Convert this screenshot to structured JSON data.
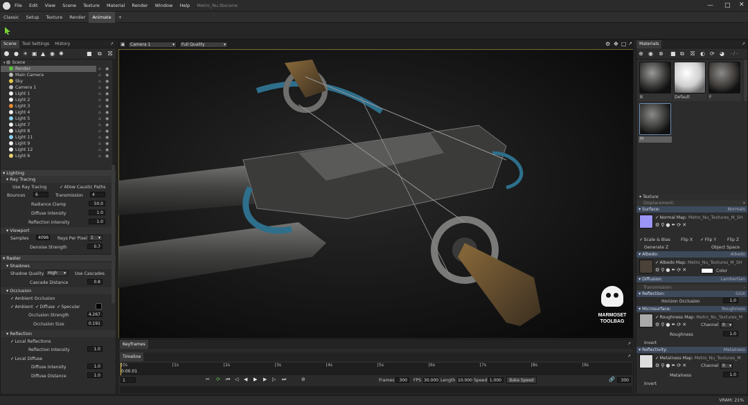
{
  "titlebar": {
    "menus": [
      "File",
      "Edit",
      "View",
      "Scene",
      "Texture",
      "Material",
      "Render",
      "Window",
      "Help"
    ],
    "filename": "Metro_Nu.tbscene"
  },
  "workspace_tabs": [
    "Classic",
    "Setup",
    "Texture",
    "Render",
    "Animate",
    "+"
  ],
  "left_panel": {
    "tabs": [
      "Scene",
      "Tool Settings",
      "History"
    ],
    "tree": {
      "root": "Scene",
      "items": [
        "Render",
        "Main Camera",
        "Sky",
        "Camera 1",
        "Light 1",
        "Light 2",
        "Light 3",
        "Light 4",
        "Light 5",
        "Light 7",
        "Light 8",
        "Light 11",
        "Light 9",
        "Light 12",
        "Light 6"
      ],
      "icon_colors": [
        "#5bbf3e",
        "#bbbbbb",
        "#e3c94a",
        "#bbbbbb",
        "#eeeeee",
        "#eeeeee",
        "#e88a30",
        "#eeeeee",
        "#8ad0f0",
        "#eeeeee",
        "#eeeeee",
        "#8ad0f0",
        "#eeeeee",
        "#eeeeee",
        "#e8d070"
      ]
    },
    "lighting": {
      "title": "Lighting",
      "ray_tracing": "Ray Tracing",
      "use_ray_tracing": "Use Ray Tracing",
      "allow_caustic": "Allow Caustic Paths",
      "bounces_label": "Bounces",
      "bounces": "6",
      "transmission_label": "Transmission",
      "transmission": "4",
      "radiance_clamp_label": "Radiance Clamp",
      "radiance_clamp": "50.0",
      "diffuse_intensity_label": "Diffuse Intensity",
      "diffuse_intensity": "1.0",
      "reflection_intensity_label": "Reflection Intensity",
      "reflection_intensity": "1.0",
      "viewport": "Viewport",
      "samples_label": "Samples",
      "samples": "4096",
      "rays_label": "Rays Per Pixel",
      "rays": "1",
      "denoise_label": "Denoise Strength",
      "denoise": "0.7"
    },
    "raster": {
      "title": "Raster",
      "shadows": "Shadows",
      "shadow_quality_label": "Shadow Quality",
      "shadow_quality": "High",
      "use_cascades": "Use Cascades",
      "cascade_label": "Cascade Distance",
      "cascade": "0.8",
      "occlusion": "Occlusion",
      "ambient_occlusion": "Ambient Occlusion",
      "ambient": "Ambient",
      "diffuse": "Diffuse",
      "specular": "Specular",
      "occ_strength_label": "Occlusion Strength",
      "occ_strength": "4.267",
      "occ_size_label": "Occlusion Size",
      "occ_size": "0.191",
      "reflection": "Reflection",
      "local_reflections": "Local Reflections",
      "refl_intensity_label": "Reflection Intensity",
      "refl_intensity": "1.0",
      "local_diffuse": "Local Diffuse",
      "diff_intensity_label": "Diffuse Intensity",
      "diff_intensity": "1.0",
      "diff_distance_label": "Diffuse Distance",
      "diff_distance": "1.0"
    }
  },
  "viewport": {
    "camera": "Camera 1",
    "quality": "Full Quality",
    "logo_line1": "MARMOSET",
    "logo_line2": "TOOLBAG"
  },
  "timeline": {
    "keyframes_tab": "Keyframes",
    "timeline_tab": "Timeline",
    "ticks": [
      "0s",
      "1s",
      "2s",
      "3s",
      "4s",
      "5s",
      "6s",
      "7s",
      "8s",
      "9s"
    ],
    "current_time": "0:00.01",
    "frame_field": "1",
    "frames_label": "Frames",
    "frames": "300",
    "fps_label": "FPS",
    "fps": "30.000",
    "length_label": "Length",
    "length": "10.000",
    "speed_label": "Speed",
    "speed": "1.000",
    "bake_speed": "Bake Speed",
    "end_frame": "300"
  },
  "materials": {
    "title": "Materials",
    "filter": "- / -",
    "items": [
      {
        "name": "B"
      },
      {
        "name": "Default"
      },
      {
        "name": "F"
      },
      {
        "name": "M"
      }
    ],
    "texture": "Texture",
    "displacement": "Displacement:",
    "surface": "Surface:",
    "surface_type": "Normals",
    "normal_map_label": "Normal Map:",
    "normal_map": "Metro_Nu_Textures_M_SH",
    "scale_bias": "Scale & Bias",
    "flip_x": "Flip X",
    "flip_y": "Flip Y",
    "flip_z": "Flip Z",
    "generate_z": "Generate Z",
    "object_space": "Object Space",
    "albedo": "Albedo:",
    "albedo_type": "Albedo",
    "albedo_map_label": "Albedo Map:",
    "albedo_map": "Metro_Nu_Textures_M_SH",
    "color_label": "Color",
    "diffusion": "Diffusion:",
    "diffusion_type": "Lambertian",
    "transmission": "Transmission:",
    "transmission_val": "-",
    "reflection": "Reflection:",
    "reflection_type": "GGX",
    "horizon_label": "Horizon Occlusion",
    "horizon": "1.0",
    "microsurface": "Microsurface:",
    "micro_type": "Roughness",
    "roughness_map_label": "Roughness Map:",
    "roughness_map": "Metro_Nu_Textures_M",
    "channel_label": "Channel",
    "channel": "R",
    "roughness_label": "Roughness",
    "roughness": "1.0",
    "invert": "Invert",
    "reflectivity": "Reflectivity:",
    "reflectivity_type": "Metalness",
    "metalness_map_label": "Metalness Map:",
    "metalness_map": "Metro_Nu_Textures_M",
    "channel2": "R",
    "metalness_label": "Metalness",
    "metalness": "1.0",
    "invert2": "Invert"
  },
  "statusbar": {
    "vram": "VRAM: 21%"
  }
}
